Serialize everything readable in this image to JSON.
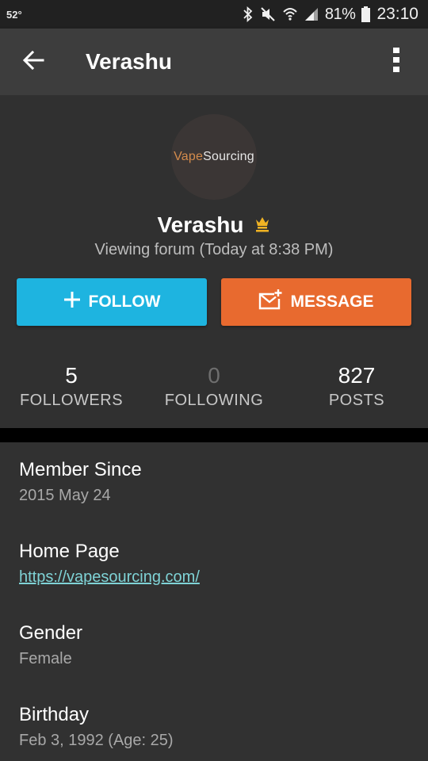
{
  "status_bar": {
    "temperature": "52°",
    "battery": "81%",
    "time": "23:10"
  },
  "app_bar": {
    "title": "Verashu"
  },
  "profile": {
    "avatar_logo": {
      "prefix": "Vape",
      "suffix": "Sourcing"
    },
    "username": "Verashu",
    "activity": "Viewing forum (Today at 8:38 PM)",
    "follow_label": "FOLLOW",
    "message_label": "MESSAGE",
    "stats": [
      {
        "value": "5",
        "label": "FOLLOWERS"
      },
      {
        "value": "0",
        "label": "FOLLOWING"
      },
      {
        "value": "827",
        "label": "POSTS"
      }
    ]
  },
  "details": [
    {
      "label": "Member Since",
      "value": "2015 May 24"
    },
    {
      "label": "Home Page",
      "value": "https://vapesourcing.com/"
    },
    {
      "label": "Gender",
      "value": "Female"
    },
    {
      "label": "Birthday",
      "value": "Feb 3, 1992 (Age: 25)"
    }
  ],
  "colors": {
    "follow": "#1eb4e0",
    "message": "#e86a2f",
    "link": "#7fd3d6",
    "badge": "#f0b323"
  }
}
